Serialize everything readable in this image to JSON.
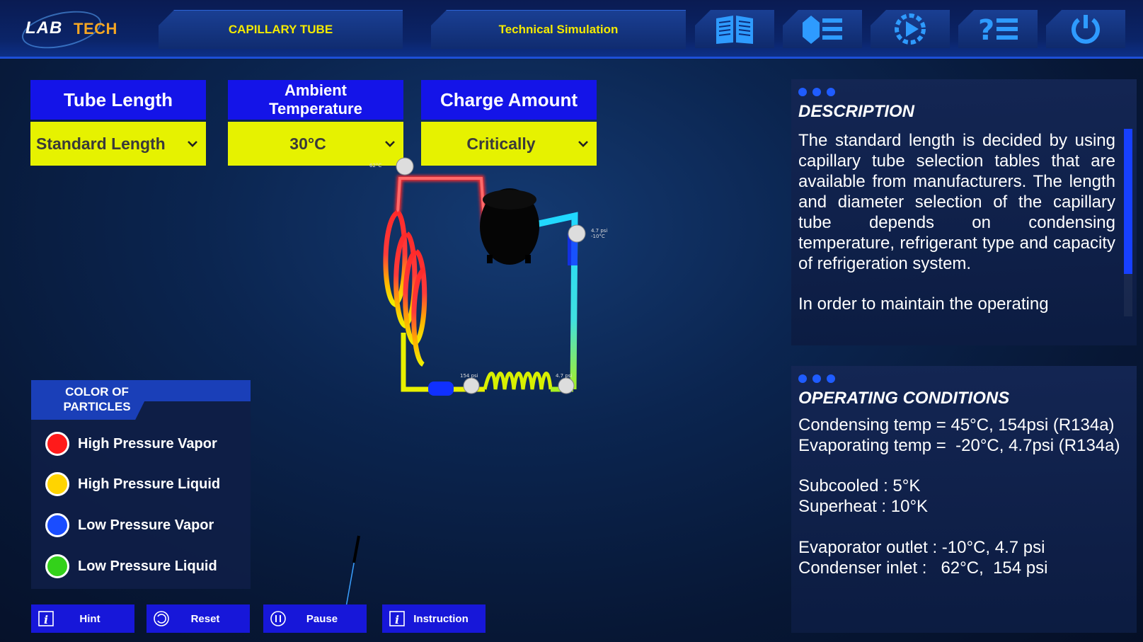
{
  "app": {
    "logo_part1": "LAB",
    "logo_part2": "TECH"
  },
  "header": {
    "tab1": "CAPILLARY TUBE",
    "tab2": "Technical Simulation",
    "icons": [
      "book-icon",
      "menu-list-icon",
      "play-gear-icon",
      "help-list-icon",
      "power-icon"
    ]
  },
  "selectors": {
    "tube_length": {
      "label": "Tube Length",
      "value": "Standard Length"
    },
    "ambient": {
      "label_line1": "Ambient",
      "label_line2": "Temperature",
      "value": "30°C"
    },
    "charge": {
      "label": "Charge Amount",
      "value": "Critically"
    }
  },
  "diagram": {
    "gauges": {
      "top": "62°C",
      "right_line1": "4.7 psi",
      "right_line2": "-10°C",
      "bottom_left": "154 psi",
      "bottom_right": "4.7 psi"
    }
  },
  "legend": {
    "title_line1": "COLOR OF",
    "title_line2": "PARTICLES",
    "items": [
      {
        "label": "High Pressure Vapor",
        "color": "#ff1a1a"
      },
      {
        "label": "High Pressure Liquid",
        "color": "#ffd400"
      },
      {
        "label": "Low Pressure Vapor",
        "color": "#1a4dff"
      },
      {
        "label": "Low Pressure Liquid",
        "color": "#33d11a"
      }
    ]
  },
  "buttons": {
    "hint": "Hint",
    "reset": "Reset",
    "pause": "Pause",
    "instruction": "Instruction"
  },
  "description": {
    "title": "DESCRIPTION",
    "para1": "The standard length is decided by using capillary tube selection tables that are available from manufacturers. The length and diameter selection of the capillary tube depends on condensing temperature, refrigerant type and capacity of refrigeration system.",
    "para2": "In order to maintain the operating"
  },
  "conditions": {
    "title": "OPERATING CONDITIONS",
    "condensing": "Condensing temp = 45°C, 154psi (R134a)",
    "evaporating": "Evaporating temp =  -20°C, 4.7psi (R134a)",
    "subcooled": "Subcooled : 5°K",
    "superheat": "Superheat : 10°K",
    "evap_outlet": "Evaporator outlet : -10°C, 4.7 psi",
    "cond_inlet": "Condenser inlet :   62°C,  154 psi"
  },
  "colors": {
    "accent_blue": "#1414e8",
    "select_yellow": "#e6f200",
    "tab_text": "#f4ea00"
  }
}
